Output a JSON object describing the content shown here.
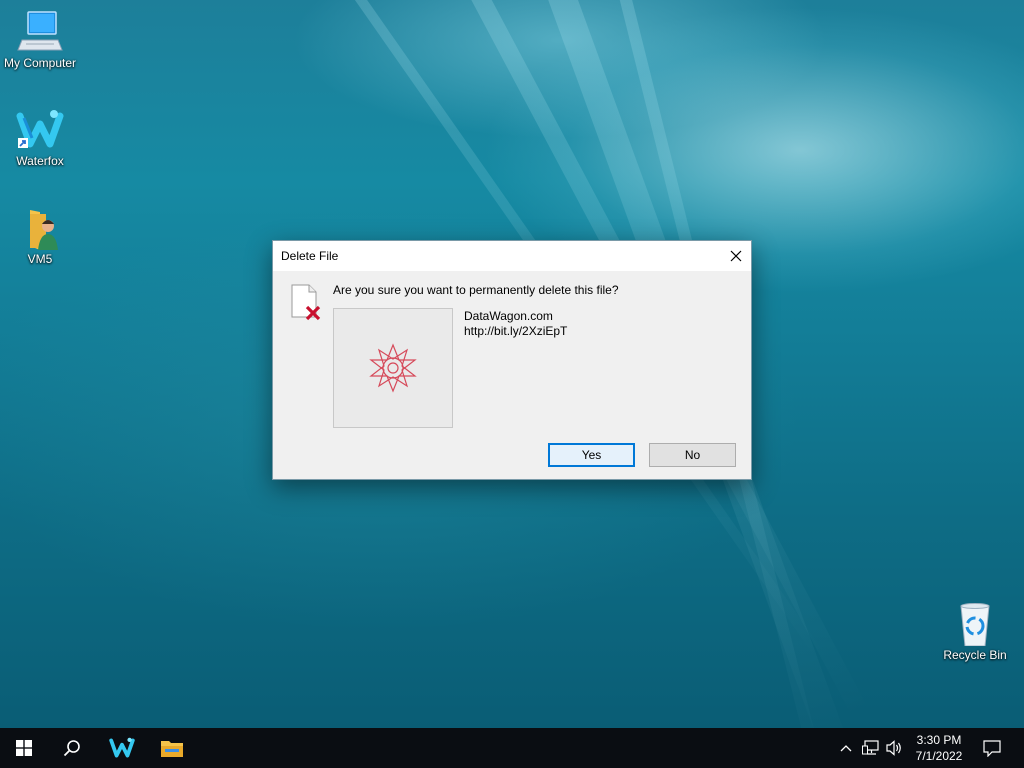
{
  "desktop": {
    "icons": [
      {
        "label": "My Computer",
        "icon": "computer-icon"
      },
      {
        "label": "Waterfox",
        "icon": "waterfox-icon"
      },
      {
        "label": "VM5",
        "icon": "user-folder-icon"
      },
      {
        "label": "Recycle Bin",
        "icon": "recycle-bin-icon"
      }
    ]
  },
  "dialog": {
    "title": "Delete File",
    "prompt": "Are you sure you want to permanently delete this file?",
    "file_name": "DataWagon.com",
    "file_detail": "http://bit.ly/2XziEpT",
    "yes_label": "Yes",
    "no_label": "No",
    "close_icon": "close-icon",
    "warning_icon": "delete-file-icon"
  },
  "taskbar": {
    "time": "3:30 PM",
    "date": "7/1/2022",
    "items": [
      "start-icon",
      "search-icon",
      "waterfox-icon",
      "file-explorer-icon"
    ],
    "tray": [
      "chevron-up-icon",
      "network-icon",
      "volume-icon",
      "notification-icon"
    ]
  },
  "colors": {
    "accent": "#0078d7",
    "delete_x": "#c8102e",
    "taskbar": "#0a0d12"
  }
}
